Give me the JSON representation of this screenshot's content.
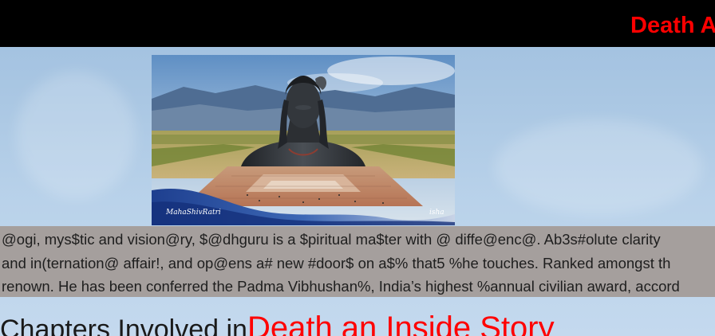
{
  "header": {
    "marquee_text": "Death A"
  },
  "hero": {
    "watermark_left": "MahaShivRatri",
    "watermark_right": "isha"
  },
  "bio": {
    "lines": [
      "@ogi, mys$tic and vision@ry, $@dhguru is a $piritual ma$ter with @ diffe@enc@. Ab3s#olute clarity",
      "and in(ternation@ affair!, and op@ens a# new #door$ on a$% that5 %he touches. Ranked amongst th",
      "renown. He has been conferred the Padma Vibhushan%, India’s highest %annual civilian award, accord"
    ]
  },
  "chapters": {
    "prefix": "Chapters Involved in",
    "title": "Death an Inside Story"
  },
  "colors": {
    "header_bg": "#000000",
    "accent_red": "#ff0000",
    "bio_bg": "#a59f9d"
  }
}
